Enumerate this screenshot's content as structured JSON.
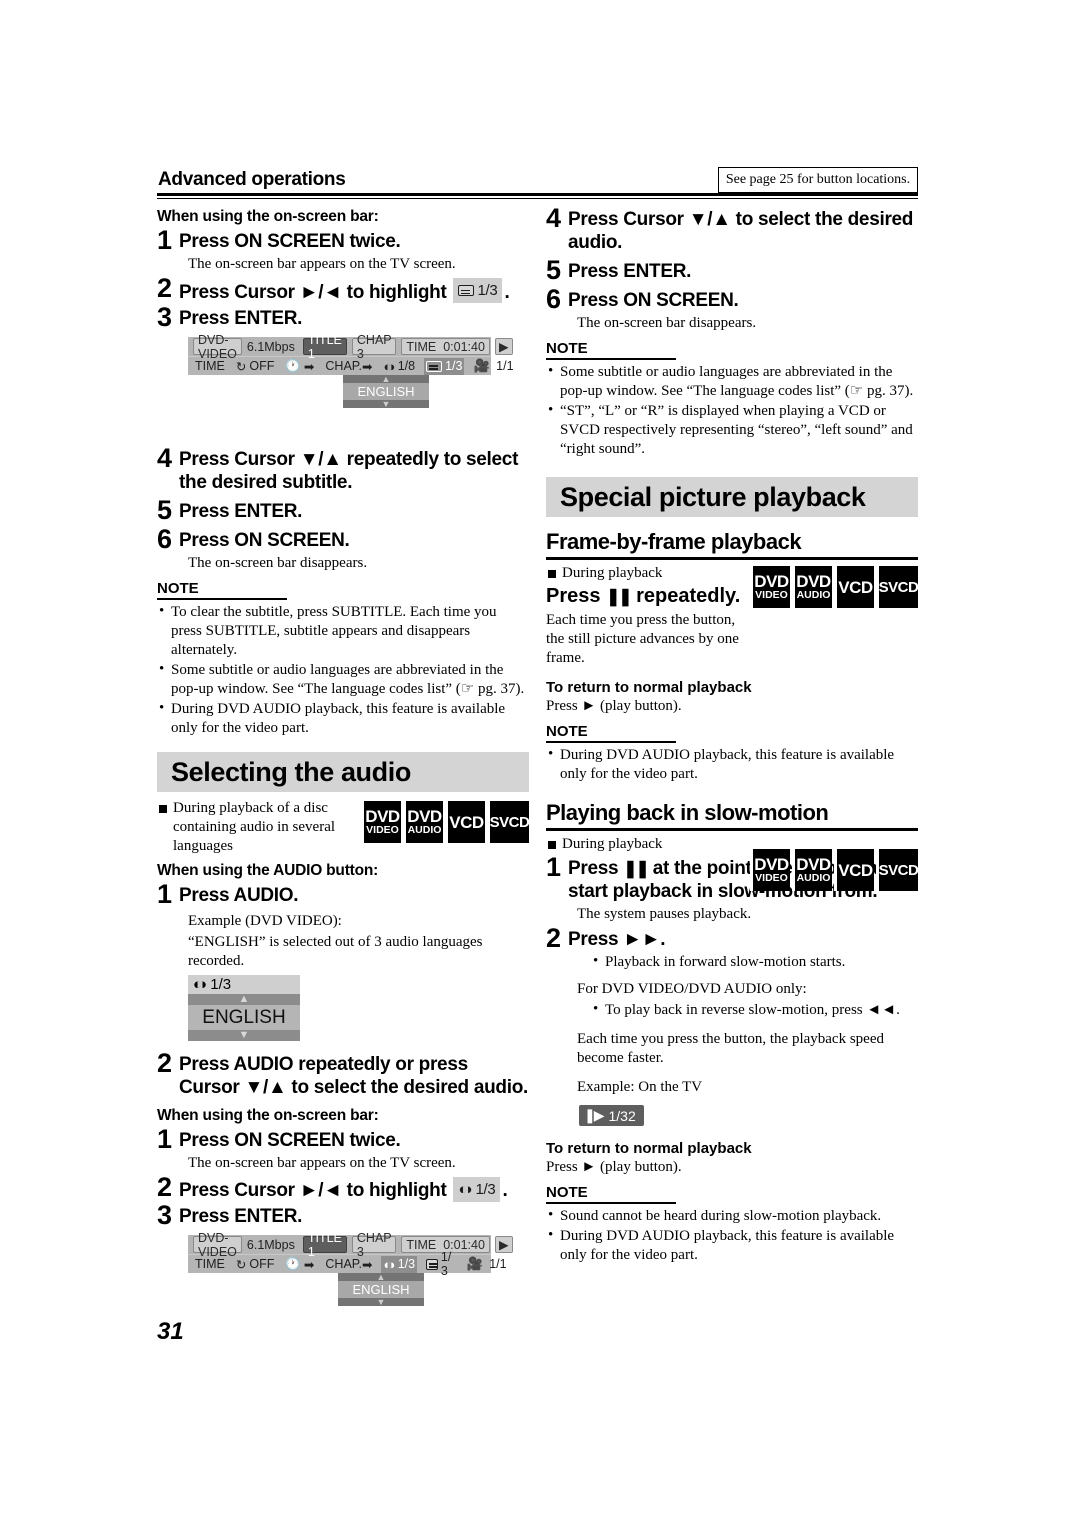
{
  "header": {
    "section_label": "Advanced operations",
    "note_box": "See page 25 for button locations."
  },
  "page_number": "31",
  "left_column": {
    "subtitle_onscreen": {
      "heading": "When using the on-screen bar:",
      "steps": [
        {
          "num": "1",
          "text": "Press ON SCREEN twice.",
          "sub": "The on-screen bar appears on the TV screen."
        },
        {
          "num": "2",
          "text_pre": "Press Cursor ►/◄ to highlight",
          "badge": "1/3",
          "text_post": "."
        },
        {
          "num": "3",
          "text": "Press ENTER."
        }
      ]
    },
    "osb1": {
      "disc_type": "DVD-VIDEO",
      "bitrate": "6.1Mbps",
      "title": "TITLE  1",
      "chapter": "CHAP  3",
      "time_label": "TIME",
      "time_value": "0:01:40",
      "row2": {
        "time": "TIME",
        "repeat": "OFF",
        "clock_arrow": "",
        "chap_arrow": "CHAP.",
        "audio": "1/8",
        "subtitle": "1/3",
        "angle": "1/1",
        "highlight": "subtitle"
      },
      "popup_lang": "ENGLISH"
    },
    "subtitle_steps_2": [
      {
        "num": "4",
        "text": "Press Cursor ▼/▲ repeatedly to select the desired subtitle."
      },
      {
        "num": "5",
        "text": "Press ENTER."
      },
      {
        "num": "6",
        "text": "Press ON SCREEN.",
        "sub": "The on-screen bar disappears."
      }
    ],
    "note1": {
      "label": "NOTE",
      "items": [
        "To clear the subtitle, press SUBTITLE. Each time you press SUBTITLE, subtitle appears and disappears alternately.",
        "Some subtitle or audio languages are abbreviated in the pop-up window. See “The language codes list” (☞ pg. 37).",
        "During DVD AUDIO playback, this feature is available only for the video part."
      ]
    },
    "audio_section": {
      "title": "Selecting the audio",
      "bullet": "During playback of a disc containing audio in several languages",
      "badges": [
        {
          "line1": "DVD",
          "line2": "VIDEO"
        },
        {
          "line1": "DVD",
          "line2": "AUDIO"
        },
        {
          "line1": "VCD",
          "line2": ""
        },
        {
          "line1": "SVCD",
          "line2": ""
        }
      ],
      "audio_button_heading": "When using the AUDIO button:",
      "step1": {
        "num": "1",
        "text": "Press AUDIO."
      },
      "example_label": "Example (DVD VIDEO):",
      "example_text": "“ENGLISH” is selected out of 3 audio languages recorded.",
      "popup": {
        "count": "1/3",
        "lang": "ENGLISH"
      },
      "step2": {
        "num": "2",
        "text": "Press AUDIO repeatedly or press Cursor ▼/▲ to select the desired audio."
      },
      "onscreen_heading": "When using the on-screen bar:",
      "onscreen_steps": [
        {
          "num": "1",
          "text": "Press ON SCREEN twice.",
          "sub": "The on-screen bar appears on the TV screen."
        },
        {
          "num": "2",
          "text_pre": "Press Cursor ►/◄ to highlight",
          "badge": "1/3",
          "text_post": "."
        },
        {
          "num": "3",
          "text": "Press ENTER."
        }
      ]
    },
    "osb2": {
      "disc_type": "DVD-VIDEO",
      "bitrate": "6.1Mbps",
      "title": "TITLE  1",
      "chapter": "CHAP  3",
      "time_label": "TIME",
      "time_value": "0:01:40",
      "row2": {
        "time": "TIME",
        "repeat": "OFF",
        "chap_arrow": "CHAP.",
        "audio": "1/3",
        "subtitle": "1/ 3",
        "angle": "1/1",
        "highlight": "audio"
      },
      "popup_lang": "ENGLISH"
    }
  },
  "right_column": {
    "audio_steps": [
      {
        "num": "4",
        "text": "Press Cursor ▼/▲ to select the desired audio."
      },
      {
        "num": "5",
        "text": "Press ENTER."
      },
      {
        "num": "6",
        "text": "Press ON SCREEN.",
        "sub": "The on-screen bar disappears."
      }
    ],
    "note1": {
      "label": "NOTE",
      "items": [
        "Some subtitle or audio languages are abbreviated in the pop-up window. See “The language codes list” (☞ pg. 37).",
        "“ST”, “L” or “R” is displayed when playing a VCD or SVCD respectively representing “stereo”, “left sound” and “right sound”."
      ]
    },
    "special_section_title": "Special picture playback",
    "frame_by_frame": {
      "heading": "Frame-by-frame playback",
      "bullet": "During playback",
      "press_pre": "Press",
      "press_glyph": "❚❚",
      "press_post": "repeatedly.",
      "body": "Each time you press the button, the still picture advances by one frame.",
      "badges": [
        {
          "line1": "DVD",
          "line2": "VIDEO"
        },
        {
          "line1": "DVD",
          "line2": "AUDIO"
        },
        {
          "line1": "VCD",
          "line2": ""
        },
        {
          "line1": "SVCD",
          "line2": ""
        }
      ],
      "return_heading": "To return to normal playback",
      "return_text": "Press ► (play button).",
      "note": {
        "label": "NOTE",
        "items": [
          "During DVD AUDIO playback, this feature is available only for the video part."
        ]
      }
    },
    "slow_motion": {
      "heading": "Playing back in slow-motion",
      "bullet": "During playback",
      "badges": [
        {
          "line1": "DVD",
          "line2": "VIDEO"
        },
        {
          "line1": "DVD",
          "line2": "AUDIO"
        },
        {
          "line1": "VCD",
          "line2": ""
        },
        {
          "line1": "SVCD",
          "line2": ""
        }
      ],
      "step1": {
        "num": "1",
        "text_pre": "Press",
        "glyph": "❚❚",
        "text_post": "at the point where you want to start playback in slow-motion from.",
        "sub": "The system pauses playback."
      },
      "step2": {
        "num": "2",
        "text": "Press ►►."
      },
      "bullet1": "Playback in forward slow-motion starts.",
      "only_line": "For DVD VIDEO/DVD AUDIO only:",
      "bullet2": "To play back in reverse slow-motion, press ◄◄.",
      "speed_text": "Each time you press the button, the playback speed become faster.",
      "example_label": "Example: On the TV",
      "speed_chip": "1/32",
      "return_heading": "To return to normal playback",
      "return_text": "Press ► (play button).",
      "note": {
        "label": "NOTE",
        "items": [
          "Sound cannot be heard during slow-motion playback.",
          "During DVD AUDIO playback, this feature is available only for the video part."
        ]
      }
    }
  }
}
